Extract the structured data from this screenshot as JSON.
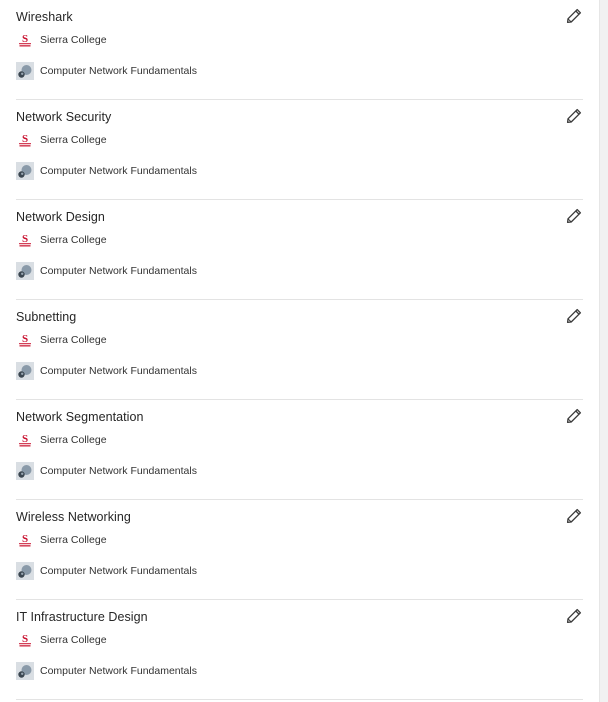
{
  "skills": [
    {
      "title": "Wireshark",
      "institution": "Sierra College",
      "course": "Computer Network Fundamentals"
    },
    {
      "title": "Network Security",
      "institution": "Sierra College",
      "course": "Computer Network Fundamentals"
    },
    {
      "title": "Network Design",
      "institution": "Sierra College",
      "course": "Computer Network Fundamentals"
    },
    {
      "title": "Subnetting",
      "institution": "Sierra College",
      "course": "Computer Network Fundamentals"
    },
    {
      "title": "Network Segmentation",
      "institution": "Sierra College",
      "course": "Computer Network Fundamentals"
    },
    {
      "title": "Wireless Networking",
      "institution": "Sierra College",
      "course": "Computer Network Fundamentals"
    },
    {
      "title": "IT Infrastructure Design",
      "institution": "Sierra College",
      "course": "Computer Network Fundamentals"
    }
  ],
  "icons": {
    "edit": "pencil-icon",
    "institution_logo": "sierra-college-logo",
    "course_logo": "course-logo-icon"
  },
  "colors": {
    "logo_red": "#c8102e",
    "divider": "#e3e3e3",
    "pencil": "#3a3a3a"
  }
}
